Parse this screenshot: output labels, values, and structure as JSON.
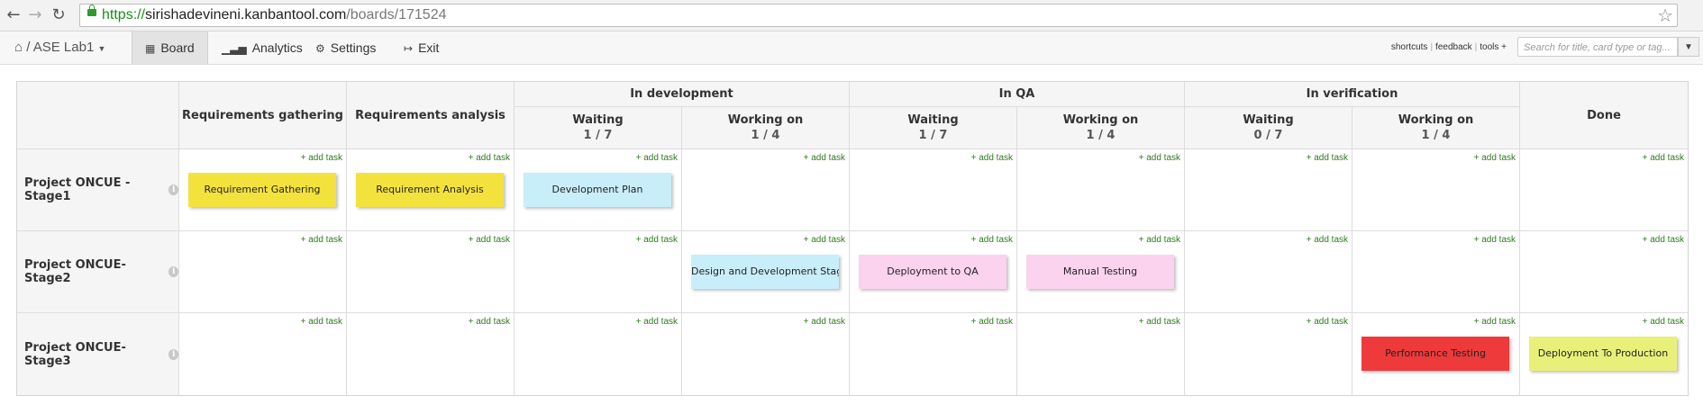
{
  "browser": {
    "url_scheme": "https://",
    "url_host": "sirishadevineni.kanbantool.com",
    "url_path": "/boards/171524"
  },
  "toolbar": {
    "board_name": "/ ASE Lab1",
    "nav": [
      {
        "label": "Board",
        "icon": "board-icon",
        "active": true
      },
      {
        "label": "Analytics",
        "icon": "bars-icon"
      },
      {
        "label": "Settings",
        "icon": "gear-icon"
      },
      {
        "label": "Exit",
        "icon": "exit-icon"
      }
    ],
    "links": [
      "shortcuts",
      "feedback",
      "tools +"
    ],
    "search_placeholder": "Search for title, card type or tag..."
  },
  "board": {
    "columns": {
      "requirements_gathering": "Requirements gathering",
      "requirements_analysis": "Requirements analysis",
      "in_development": "In development",
      "in_qa": "In QA",
      "in_verification": "In verification",
      "done": "Done",
      "waiting": "Waiting",
      "working_on": "Working on",
      "dev_waiting_wip": "1 / 7",
      "dev_working_wip": "1 / 4",
      "qa_waiting_wip": "1 / 7",
      "qa_working_wip": "1 / 4",
      "ver_waiting_wip": "0 / 7",
      "ver_working_wip": "1 / 4"
    },
    "add_task_label": "+ add task",
    "rows": [
      "Project ONCUE -Stage1",
      "Project ONCUE- Stage2",
      "Project ONCUE- Stage3"
    ],
    "cards": {
      "requirement_gathering": "Requirement Gathering",
      "requirement_analysis": "Requirement Analysis",
      "development_plan": "Development Plan",
      "design_and_development": "Design and Development Stage",
      "deployment_to_qa": "Deployment to QA",
      "manual_testing": "Manual Testing",
      "performance_testing": "Performance Testing",
      "deployment_to_production": "Deployment To Production"
    },
    "card_colors": {
      "yellow": "#f4e23c",
      "light_blue": "#c8eef9",
      "pink": "#fbd3ee",
      "red": "#ee3a3a",
      "lime": "#e8f07a"
    }
  }
}
